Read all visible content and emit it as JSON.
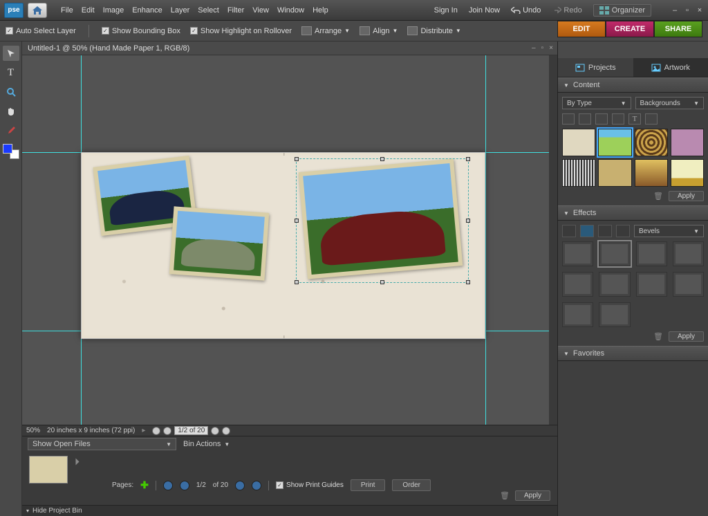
{
  "menubar": {
    "logo": "pse",
    "items": [
      "File",
      "Edit",
      "Image",
      "Enhance",
      "Layer",
      "Select",
      "Filter",
      "View",
      "Window",
      "Help"
    ],
    "sign_in": "Sign In",
    "join_now": "Join Now",
    "undo": "Undo",
    "redo": "Redo",
    "organizer": "Organizer"
  },
  "options": {
    "auto_select": "Auto Select Layer",
    "show_bbox": "Show Bounding Box",
    "show_highlight": "Show Highlight on Rollover",
    "arrange": "Arrange",
    "align": "Align",
    "distribute": "Distribute"
  },
  "modes": {
    "edit": "EDIT",
    "create": "CREATE",
    "share": "SHARE"
  },
  "document": {
    "title": "Untitled-1 @ 50% (Hand Made Paper 1, RGB/8)",
    "zoom": "50%",
    "dims": "20 inches x 9 inches (72 ppi)",
    "page_display": "1/2 of 20"
  },
  "filmstrip": {
    "show_open": "Show Open Files",
    "bin_actions": "Bin Actions",
    "pages_label": "Pages:",
    "page": "1/2",
    "total": "of 20",
    "show_guides": "Show Print Guides",
    "print": "Print",
    "order": "Order",
    "hide_bin": "Hide Project Bin",
    "apply": "Apply"
  },
  "rightpanel": {
    "tab_projects": "Projects",
    "tab_artwork": "Artwork",
    "content_head": "Content",
    "filter_by": "By Type",
    "filter_cat": "Backgrounds",
    "apply": "Apply",
    "effects_head": "Effects",
    "effects_dd": "Bevels",
    "favorites_head": "Favorites"
  },
  "colors": {
    "bg_thumbs": [
      "#e0d8c0",
      "#9dd05a",
      "#caa24a",
      "#b98ab0",
      "#888",
      "#c8b070",
      "#8a5a2a",
      "#f0eec0"
    ]
  }
}
